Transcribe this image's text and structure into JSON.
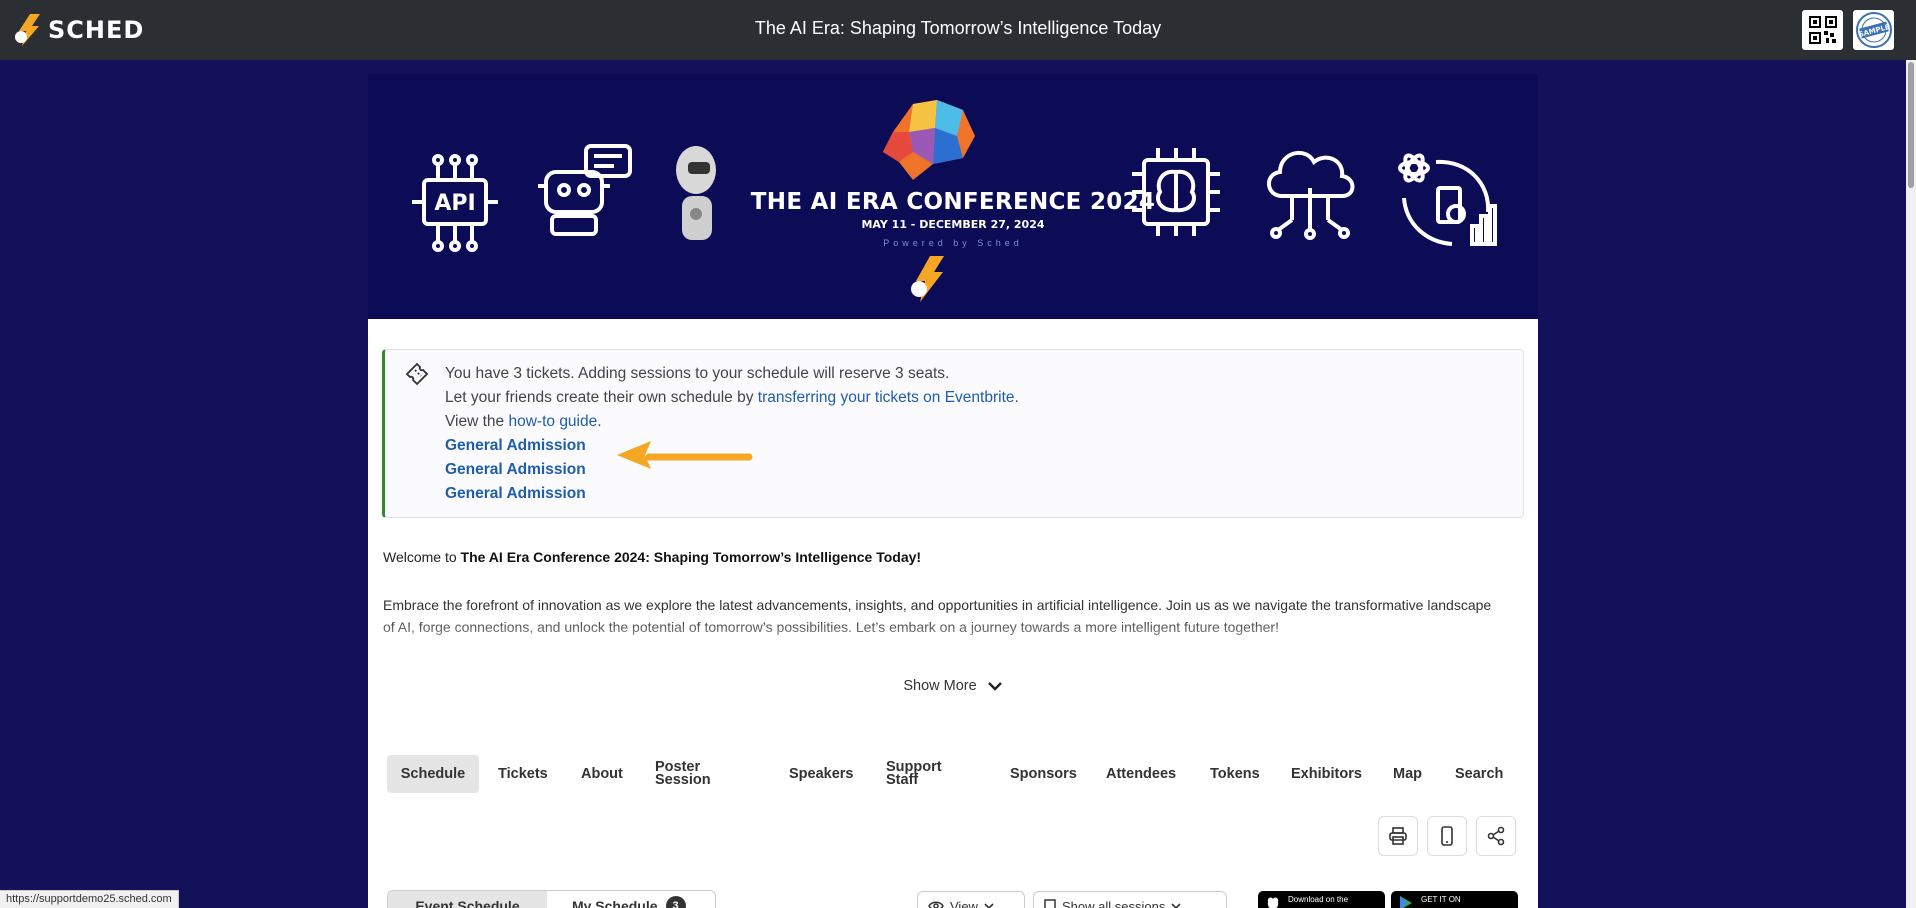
{
  "app": {
    "name": "SCHED",
    "title": "The AI Era: Shaping Tomorrow’s Intelligence Today"
  },
  "banner": {
    "title": "THE AI ERA CONFERENCE 2024",
    "dates": "MAY 11 - DECEMBER 27, 2024",
    "powered": "Powered by Sched",
    "icons": [
      "api-icon",
      "chatbot-icon",
      "humanoid-robot-icon",
      "brain-icon",
      "chip-brain-icon",
      "cloud-circuit-icon",
      "data-science-icon"
    ]
  },
  "tickets": {
    "line1": "You have 3 tickets. Adding sessions to your schedule will reserve 3 seats.",
    "line2_prefix": "Let your friends create their own schedule by ",
    "line2_link": "transferring your tickets on Eventbrite",
    "line2_suffix": ".",
    "line3_prefix": "View the ",
    "line3_link": "how-to guide",
    "line3_suffix": ".",
    "items": [
      "General Admission",
      "General Admission",
      "General Admission"
    ]
  },
  "intro": {
    "welcome_prefix": "Welcome to ",
    "welcome_bold": "The AI Era Conference 2024: Shaping Tomorrow’s Intelligence Today!",
    "description": "Embrace the forefront of innovation as we explore the latest advancements, insights, and opportunities in artificial intelligence. Join us as we navigate the transformative landscape of AI, forge connections, and unlock the potential of tomorrow’s possibilities. Let’s embark on a journey towards a more intelligent future together!",
    "show_more": "Show More"
  },
  "nav": {
    "tabs": [
      "Schedule",
      "Tickets",
      "About",
      "Poster Session",
      "Speakers",
      "Support Staff",
      "Sponsors",
      "Attendees",
      "Tokens",
      "Exhibitors",
      "Map",
      "Search"
    ],
    "active": "Schedule"
  },
  "schedule_toggle": {
    "event": "Event Schedule",
    "mine": "My Schedule",
    "count": "3"
  },
  "filters": {
    "view": "View",
    "sessions": "Show all sessions"
  },
  "stores": {
    "apple_small": "Download on the",
    "google_small": "GET IT ON"
  },
  "status_url": "https://supportdemo25.sched.com",
  "colors": {
    "page_bg": "#13115a",
    "topbar": "#2b2f33",
    "link": "#1f5ea8",
    "accent_border": "#2e8b2e",
    "arrow": "#f5a623"
  }
}
